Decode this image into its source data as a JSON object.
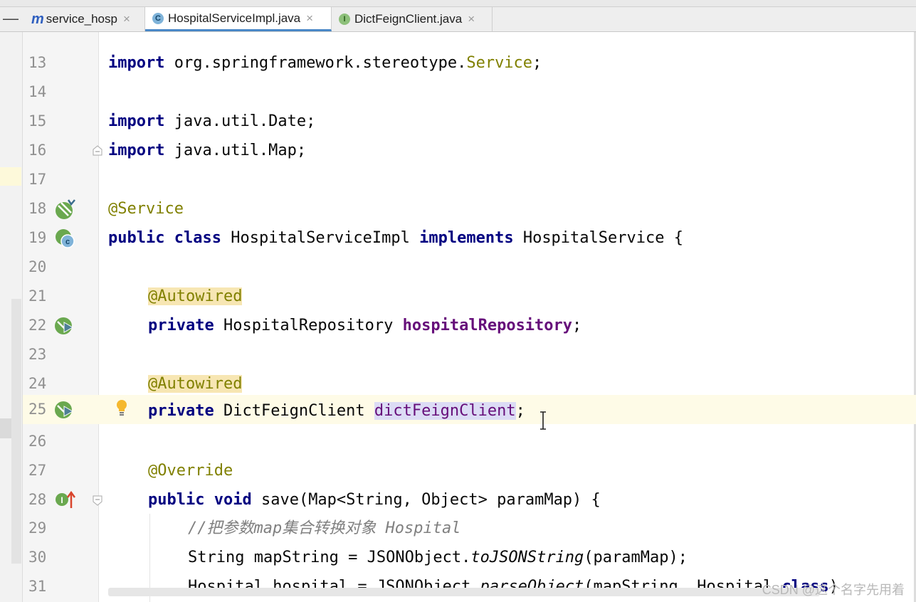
{
  "tabs": [
    {
      "label": "service_hosp",
      "icon": "module-icon",
      "active": false
    },
    {
      "label": "HospitalServiceImpl.java",
      "icon": "class-icon",
      "active": true
    },
    {
      "label": "DictFeignClient.java",
      "icon": "interface-icon",
      "active": false
    }
  ],
  "tab_collapse_label": "—",
  "close_glyph": "×",
  "class_icon_letter": "C",
  "interface_icon_letter": "I",
  "module_icon_letter": "m",
  "lines": {
    "l13": {
      "num": "13",
      "t1": "import",
      "t2": " org.springframework.stereotype.",
      "t3": "Service",
      "t4": ";"
    },
    "l14": {
      "num": "14"
    },
    "l15": {
      "num": "15",
      "t1": "import",
      "t2": " java.util.Date;"
    },
    "l16": {
      "num": "16",
      "t1": "import",
      "t2": " java.util.Map;"
    },
    "l17": {
      "num": "17"
    },
    "l18": {
      "num": "18",
      "t1": "@Service"
    },
    "l19": {
      "num": "19",
      "t1": "public",
      "t2": " ",
      "t3": "class",
      "t4": " HospitalServiceImpl ",
      "t5": "implements",
      "t6": " HospitalService {"
    },
    "l20": {
      "num": "20"
    },
    "l21": {
      "num": "21",
      "t1": "@Autowired"
    },
    "l22": {
      "num": "22",
      "t1": "private",
      "t2": " HospitalRepository ",
      "t3": "hospitalRepository",
      "t4": ";"
    },
    "l23": {
      "num": "23"
    },
    "l24": {
      "num": "24",
      "t1": "@Autowired"
    },
    "l25": {
      "num": "25",
      "t1": "private",
      "t2": " DictFeignClient ",
      "t3": "dictFeignClient",
      "t4": ";"
    },
    "l26": {
      "num": "26"
    },
    "l27": {
      "num": "27",
      "t1": "@Override"
    },
    "l28": {
      "num": "28",
      "t1": "public",
      "t2": " ",
      "t3": "void",
      "t4": " save(Map<String, Object> paramMap) {"
    },
    "l29": {
      "num": "29",
      "t1": "//把参数map集合转换对象 Hospital"
    },
    "l30": {
      "num": "30",
      "t1": "String mapString = JSONObject.",
      "t2": "toJSONString",
      "t3": "(paramMap);"
    },
    "l31": {
      "num": "31",
      "t1": "Hospital hospital = JSONObject.",
      "t2": "parseObject",
      "t3": "(mapString, Hospital.",
      "t4": "class",
      "t5": ")"
    }
  },
  "watermark": "CSDN @这个名字先用着",
  "colors": {
    "keyword": "#000080",
    "annotation": "#808000",
    "field": "#660e7a",
    "comment": "#808080",
    "current_line": "#fefbe7",
    "selection": "#dcdcf5"
  }
}
